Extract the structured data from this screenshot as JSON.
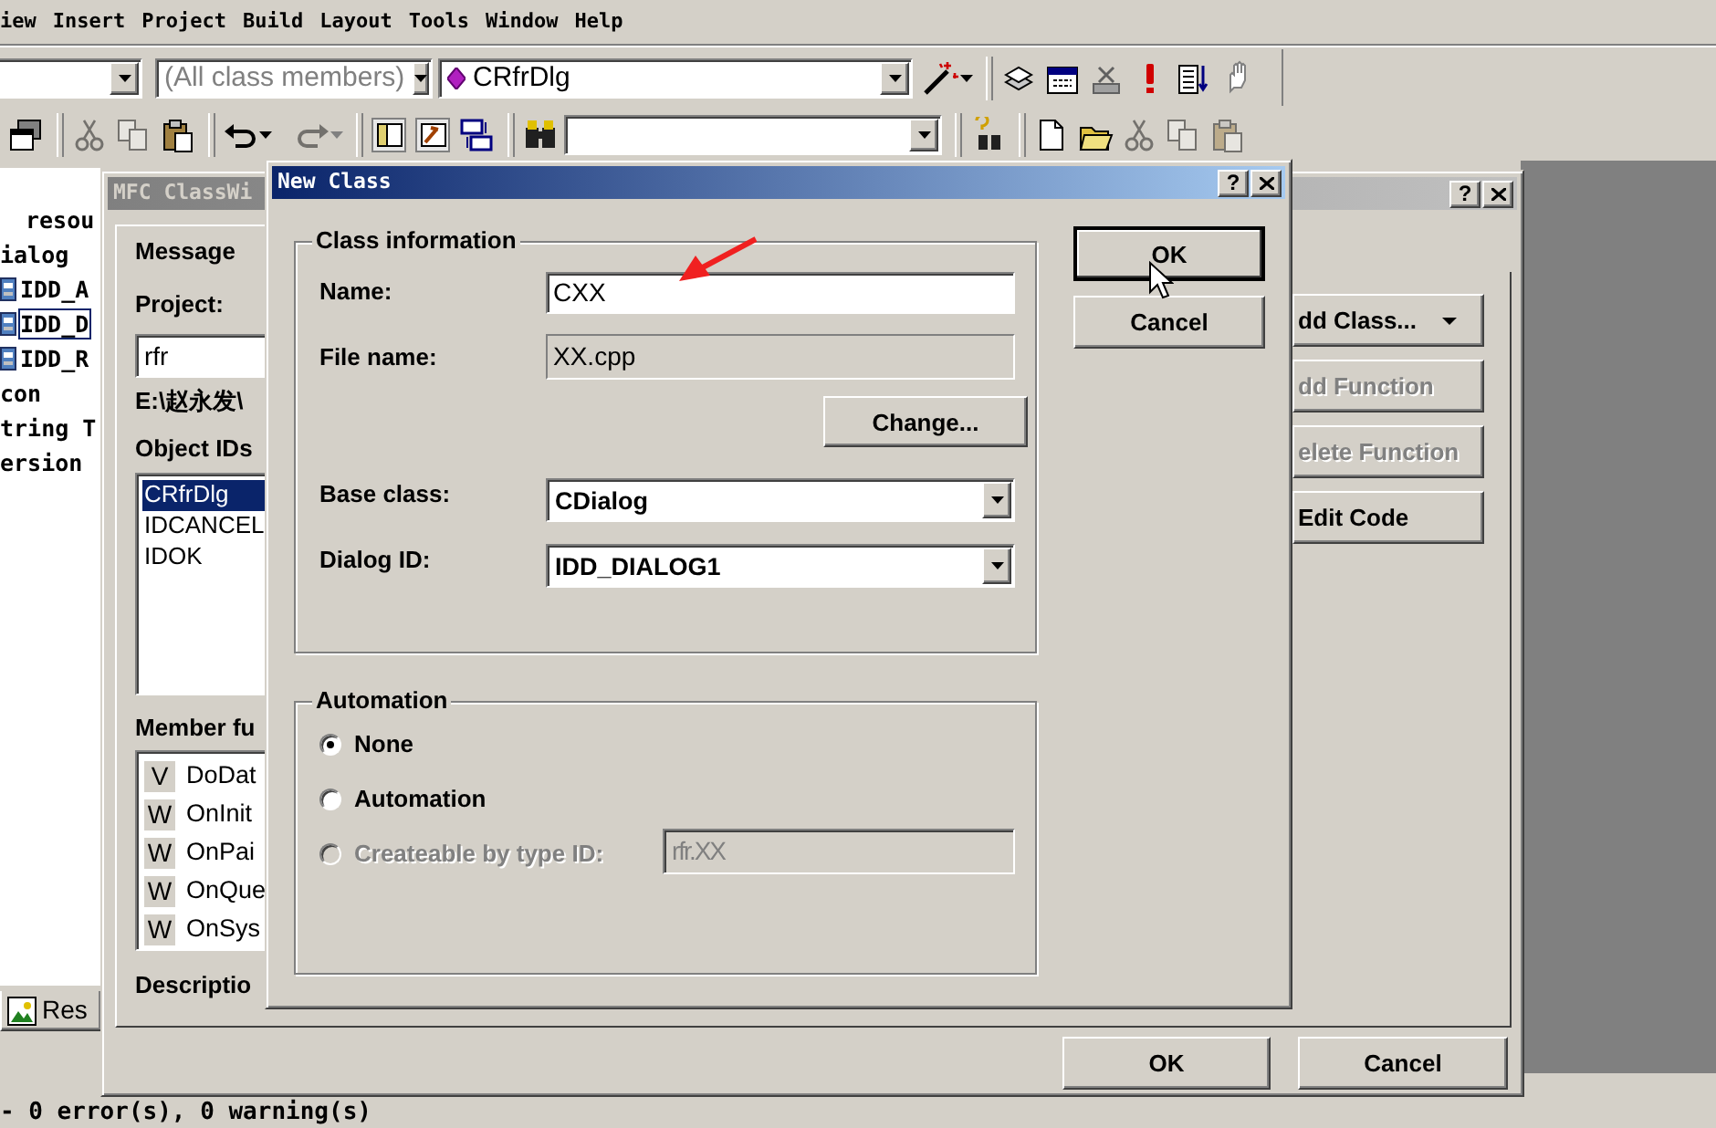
{
  "menu_bar": [
    "iew",
    "Insert",
    "Project",
    "Build",
    "Layout",
    "Tools",
    "Window",
    "Help"
  ],
  "toolbar": {
    "filter_combo": {
      "value": "(All class members)",
      "disabled": true
    },
    "member_combo": {
      "value": "CRfrDlg"
    }
  },
  "workspace": {
    "tree": [
      {
        "label": "resou",
        "children": [
          {
            "label": "ialog",
            "children": [
              {
                "label": "IDD_A",
                "selected": false
              },
              {
                "label": "IDD_D",
                "selected": true
              },
              {
                "label": "IDD_R",
                "selected": false
              }
            ]
          },
          {
            "label": "con"
          },
          {
            "label": "tring T"
          },
          {
            "label": "ersion"
          }
        ]
      }
    ],
    "tab": "Res"
  },
  "output": "- 0 error(s), 0 warning(s)",
  "class_wizard": {
    "title": "MFC ClassWi",
    "help_button": "?",
    "tab": "Message",
    "project_label": "Project:",
    "project": "rfr",
    "path": "E:\\赵永发\\",
    "object_ids_label": "Object IDs",
    "object_ids": [
      {
        "label": "CRfrDlg",
        "selected": true
      },
      {
        "label": "IDCANCEL",
        "selected": false
      },
      {
        "label": "IDOK",
        "selected": false
      }
    ],
    "member_functions_label": "Member fu",
    "member_functions": [
      {
        "type": "V",
        "name": "DoDat"
      },
      {
        "type": "W",
        "name": "OnInit"
      },
      {
        "type": "W",
        "name": "OnPai"
      },
      {
        "type": "W",
        "name": "OnQue"
      },
      {
        "type": "W",
        "name": "OnSys"
      }
    ],
    "description_label": "Descriptio",
    "side_buttons": [
      {
        "label": "dd Class...",
        "disabled": false,
        "dropdown": true
      },
      {
        "label": "dd Function",
        "disabled": true,
        "dropdown": false
      },
      {
        "label": "elete Function",
        "disabled": true,
        "dropdown": false
      },
      {
        "label": "Edit Code",
        "disabled": false,
        "dropdown": false
      }
    ],
    "buttons": [
      "OK",
      "Cancel"
    ]
  },
  "new_class": {
    "title": "New Class",
    "help_button": "?",
    "class_info": {
      "title": "Class information",
      "name": {
        "label": "Name:",
        "value": "CXX"
      },
      "file_name": {
        "label": "File name:",
        "value": "XX.cpp",
        "disabled": true
      },
      "change_button": "Change...",
      "base_class": {
        "label": "Base class:",
        "value": "CDialog"
      },
      "dialog_id": {
        "label": "Dialog ID:",
        "value": "IDD_DIALOG1"
      }
    },
    "buttons": [
      {
        "label": "OK",
        "default": true
      },
      {
        "label": "Cancel",
        "default": false
      }
    ],
    "automation": {
      "title": "Automation",
      "options": [
        {
          "label": "None",
          "selected": true,
          "disabled": false
        },
        {
          "label": "Automation",
          "selected": false,
          "disabled": false
        },
        {
          "label": "Createable by type ID:",
          "selected": false,
          "disabled": true
        }
      ],
      "type_id": {
        "value": "rfr.XX",
        "disabled": true
      }
    }
  }
}
